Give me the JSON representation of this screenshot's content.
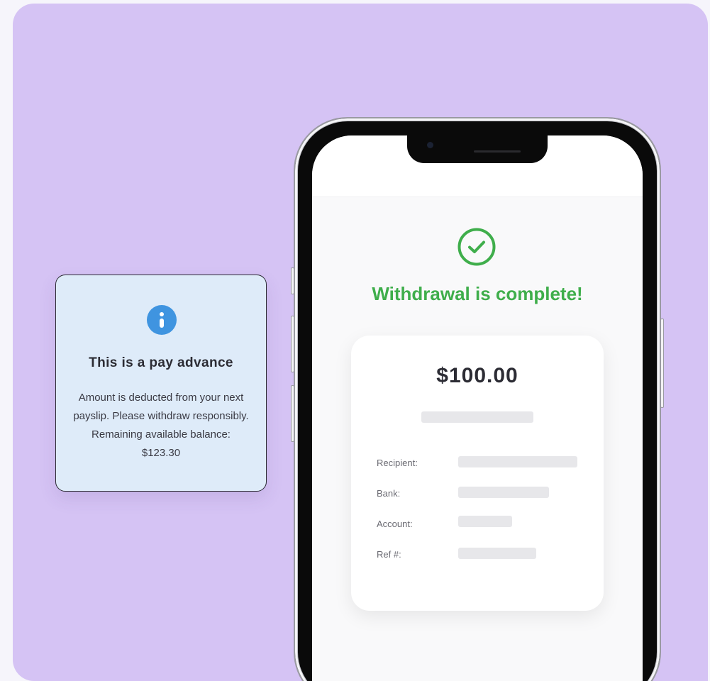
{
  "colors": {
    "background": "#d5c3f4",
    "info_card": "#deebf9",
    "info_icon": "#3f94e0",
    "success": "#3fae4b",
    "skeleton": "#e7e7ea"
  },
  "info_card": {
    "icon": "info-icon",
    "title": "This is a pay advance",
    "body": "Amount is deducted from your next payslip. Please withdraw responsibly. Remaining available balance: $123.30"
  },
  "receipt_screen": {
    "status_icon": "check-circle-icon",
    "title": "Withdrawal is complete!",
    "amount": "$100.00",
    "rows": [
      {
        "label": "Recipient:"
      },
      {
        "label": "Bank:"
      },
      {
        "label": "Account:"
      },
      {
        "label": "Ref #:"
      }
    ]
  }
}
